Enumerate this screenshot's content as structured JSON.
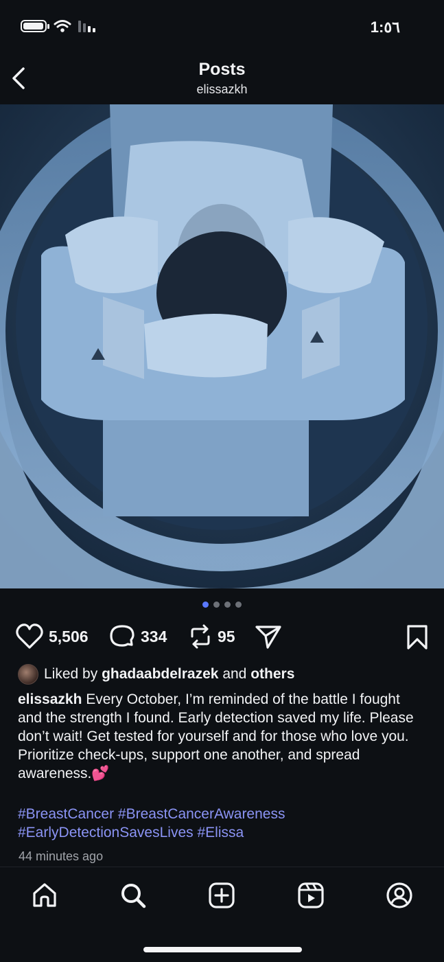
{
  "status_bar": {
    "time": "1:٥٦",
    "battery_level": 0.85
  },
  "header": {
    "title": "Posts",
    "subtitle": "elissazkh"
  },
  "carousel": {
    "total": 4,
    "active_index": 0
  },
  "actions": {
    "likes": "5,506",
    "comments": "334",
    "reposts": "95"
  },
  "liked_by": {
    "prefix": "Liked by",
    "user": "ghadaabdelrazek",
    "conjunction": "and",
    "others": "others"
  },
  "caption": {
    "username": "elissazkh",
    "text": "Every October, I’m reminded of the battle I fought and the strength I found. Early detection saved my life. Please don’t wait! Get tested for yourself and for those who love you. Prioritize check-ups, support one another, and spread awareness.💕"
  },
  "hashtags": "#BreastCancer #BreastCancerAwareness #EarlyDetectionSavesLives #Elissa",
  "timestamp": "44 minutes ago",
  "colors": {
    "background": "#0d1014",
    "hashtag": "#8b94f5",
    "dot_active": "#5a78ff"
  }
}
